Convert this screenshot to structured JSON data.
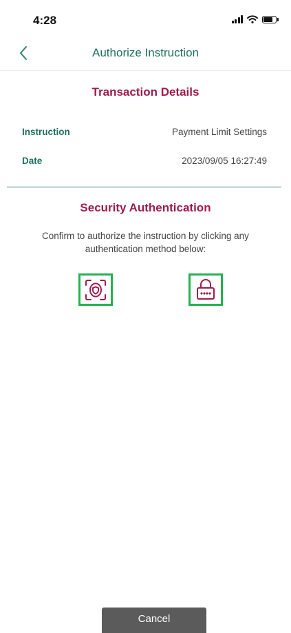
{
  "status_bar": {
    "time": "4:28",
    "battery_level": "75%",
    "icons": [
      "cellular-signal-icon",
      "wifi-icon",
      "battery-icon"
    ]
  },
  "nav": {
    "title": "Authorize Instruction",
    "back_icon": "chevron-left-icon"
  },
  "transaction": {
    "title": "Transaction Details",
    "rows": [
      {
        "label": "Instruction",
        "value": "Payment Limit Settings"
      },
      {
        "label": "Date",
        "value": "2023/09/05 16:27:49"
      }
    ]
  },
  "security": {
    "title": "Security Authentication",
    "instructions": "Confirm to authorize the instruction by clicking any authentication method below:",
    "methods": [
      {
        "icon": "face-id-icon"
      },
      {
        "icon": "pin-lock-icon"
      }
    ]
  },
  "footer": {
    "cancel_label": "Cancel"
  },
  "colors": {
    "brand_green": "#1f6f5f",
    "brand_maroon": "#9e1c4b",
    "highlight_green": "#22b24c",
    "cancel_bg": "#5b5b5b"
  }
}
